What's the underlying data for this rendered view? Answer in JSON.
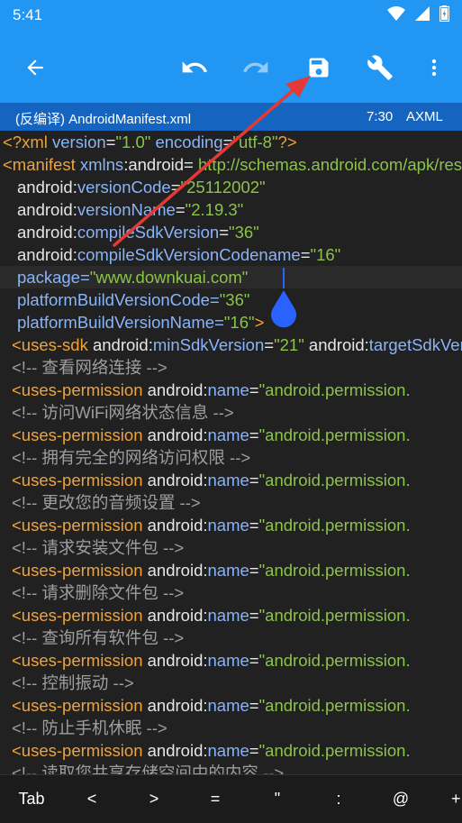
{
  "status": {
    "time": "5:41"
  },
  "appbar": {
    "back_icon": "arrow-back-icon",
    "undo_icon": "undo-icon",
    "redo_icon": "redo-icon",
    "save_icon": "save-icon",
    "tools_icon": "wrench-icon",
    "more_icon": "more-vert-icon"
  },
  "file": {
    "name": "(反编译) AndroidManifest.xml",
    "position": "7:30",
    "mode": "AXML"
  },
  "colors": {
    "primary": "#2196f3",
    "primary_dark": "#1565c0",
    "annotation_arrow": "#e53935",
    "cursor_handle": "#2962ff"
  },
  "code": {
    "l1": {
      "pi_open": "<?xml ",
      "a1": "version",
      "eq1": "=",
      "v1": "\"1.0\"",
      "sp": " ",
      "a2": "encoding",
      "eq2": "=",
      "v2": "\"utf-8\"",
      "pi_close": "?>"
    },
    "l2": {
      "open": "<manifest ",
      "ns": "xmlns",
      "colon": ":",
      "name": "android",
      "eq": "= ",
      "val": "http://schemas.android.com/apk/res/android\""
    },
    "l3": {
      "ns": "android",
      "colon": ":",
      "name": "versionCode",
      "eq": "=",
      "val": "\"25112002\""
    },
    "l4": {
      "ns": "android",
      "colon": ":",
      "name": "versionName",
      "eq": "=",
      "val": "\"2.19.3\""
    },
    "l5": {
      "ns": "android",
      "colon": ":",
      "name": "compileSdkVersion",
      "eq": "=",
      "val": "\"36\""
    },
    "l6": {
      "ns": "android",
      "colon": ":",
      "name": "compileSdkVersionCodename",
      "eq": "=",
      "val": "\"16\""
    },
    "l7": {
      "name": "package",
      "eq": "=",
      "val": "\"www.downkuai.com\""
    },
    "l8": {
      "name": "platformBuildVersionCode",
      "eq": "=",
      "val": "\"36\""
    },
    "l9": {
      "name": "platformBuildVersionName",
      "eq": "=",
      "val": "\"16\"",
      "close": ">"
    },
    "l10": {
      "open": "<uses-sdk ",
      "ns": "android",
      "colon": ":",
      "name": "minSdkVersion",
      "eq": "=",
      "val": "\"21\"",
      "sp": " ",
      "ns2": "android",
      "colon2": ":",
      "name2": "targetSdkVersion"
    },
    "perm_tag": "<uses-permission ",
    "perm_ns": "android",
    "perm_colon": ":",
    "perm_name": "name",
    "perm_eq": "=",
    "perm_val": "\"android.permission.",
    "comments": [
      "<!-- 查看网络连接 -->",
      "<!-- 访问WiFi网络状态信息 -->",
      "<!-- 拥有完全的网络访问权限 -->",
      "<!-- 更改您的音频设置 -->",
      "<!-- 请求安装文件包 -->",
      "<!-- 请求删除文件包 -->",
      "<!-- 查询所有软件包 -->",
      "<!-- 控制振动 -->",
      "<!-- 防止手机休眠 -->",
      "<!-- 读取您共享存储空间中的内容 -->"
    ]
  },
  "symbols": [
    "Tab",
    "<",
    ">",
    "=",
    "\"",
    ":",
    "@",
    "+"
  ]
}
